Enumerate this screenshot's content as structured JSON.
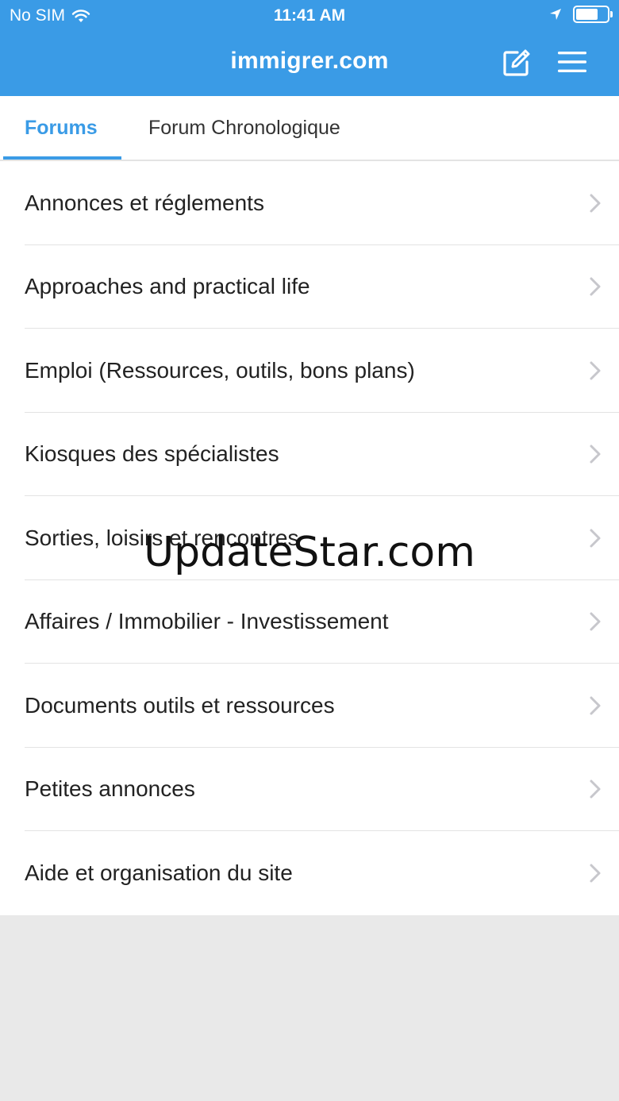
{
  "status_bar": {
    "carrier": "No SIM",
    "time": "11:41 AM",
    "battery_level": 0.72
  },
  "nav": {
    "title": "immigrer.com",
    "compose_icon": "compose-icon",
    "menu_icon": "hamburger-menu-icon"
  },
  "tabs": [
    {
      "label": "Forums",
      "active": true
    },
    {
      "label": "Forum Chronologique",
      "active": false
    }
  ],
  "forums": [
    {
      "label": "Annonces et réglements"
    },
    {
      "label": "Approaches and practical life"
    },
    {
      "label": "Emploi (Ressources, outils, bons plans)"
    },
    {
      "label": "Kiosques des spécialistes"
    },
    {
      "label": "Sorties, loisirs et rencontres"
    },
    {
      "label": "Affaires / Immobilier - Investissement"
    },
    {
      "label": "Documents outils et ressources"
    },
    {
      "label": "Petites annonces"
    },
    {
      "label": "Aide et organisation du site"
    }
  ],
  "watermark": "UpdateStar.com",
  "colors": {
    "accent": "#3a9be6",
    "background": "#e9e9e9",
    "separator": "#e3e3e3",
    "chevron": "#c7c7cc"
  }
}
